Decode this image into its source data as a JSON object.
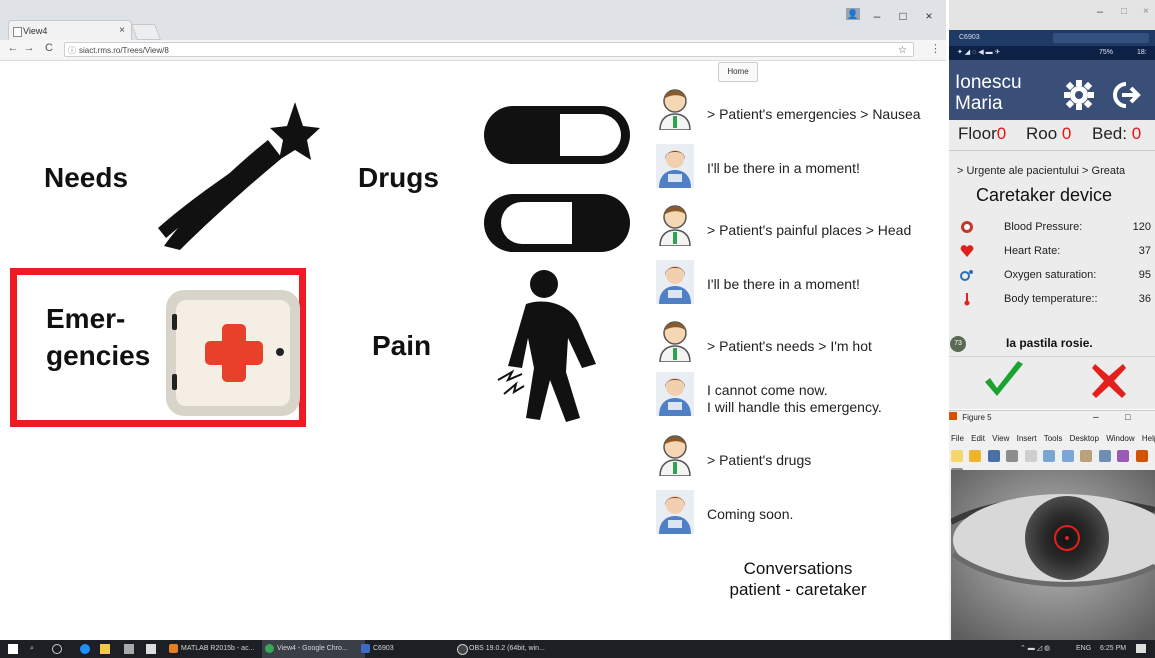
{
  "browser": {
    "tab_title": "View4",
    "tab_close": "×",
    "url": "siact.rms.ro/Trees/View/8",
    "window_controls": [
      "–",
      "□",
      "×"
    ]
  },
  "home_button": "Home",
  "tiles": [
    {
      "label": "Needs",
      "icon": "shooting-star-icon"
    },
    {
      "label": "Drugs",
      "icon": "pills-icon"
    },
    {
      "label": "Emer-\ngencies",
      "icon": "first-aid-kit-icon"
    },
    {
      "label": "Pain",
      "icon": "pain-person-icon"
    }
  ],
  "colors": {
    "emergency_frame": "#ee1b24",
    "accept": "#1aa32e",
    "reject": "#e3211c",
    "phone_header": "#3a4f78"
  },
  "conversation": {
    "messages": [
      {
        "from": "patient",
        "text": "> Patient's emergencies > Nausea"
      },
      {
        "from": "caretaker",
        "text": "I'll be there in a moment!"
      },
      {
        "from": "patient",
        "text": "> Patient's painful places > Head"
      },
      {
        "from": "caretaker",
        "text": "I'll be there in a moment!"
      },
      {
        "from": "patient",
        "text": "> Patient's needs > I'm hot"
      },
      {
        "from": "caretaker",
        "text": "I cannot come now.\nI will handle this emergency."
      },
      {
        "from": "patient",
        "text": "> Patient's drugs"
      },
      {
        "from": "caretaker",
        "text": "Coming soon."
      }
    ],
    "caption_line1": "Conversations",
    "caption_line2": "patient - caretaker"
  },
  "phone": {
    "window_title": "C6903",
    "status_time": "18:",
    "status_battery": "75%",
    "patient_name_line1": "Ionescu",
    "patient_name_line2": "Maria",
    "floor_label": "Floor",
    "floor_value": "0",
    "room_label": "Roo",
    "room_value": "0",
    "bed_label": "Bed:",
    "bed_value": "0",
    "emergency_path": "> Urgente ale pacientului > Greata",
    "device_title": "Caretaker device",
    "vitals": [
      {
        "icon": "blood-pressure-icon",
        "label": "Blood Pressure:",
        "value": "120"
      },
      {
        "icon": "heart-icon",
        "label": "Heart Rate:",
        "value": "37"
      },
      {
        "icon": "oxygen-icon",
        "label": "Oxygen saturation:",
        "value": "95"
      },
      {
        "icon": "thermometer-icon",
        "label": "Body temperature::",
        "value": "36"
      }
    ],
    "badge": "73",
    "pill_message": "Ia pastila rosie."
  },
  "figure": {
    "title": "Figure 5",
    "menu": [
      "File",
      "Edit",
      "View",
      "Insert",
      "Tools",
      "Desktop",
      "Window",
      "Help"
    ]
  },
  "taskbar": {
    "apps": [
      "MATLAB R2015b - ac...",
      "View4 - Google Chro...",
      "C6903",
      "OBS 19.0.2 (64bit, win..."
    ],
    "language": "ENG",
    "time": "6:25 PM"
  }
}
